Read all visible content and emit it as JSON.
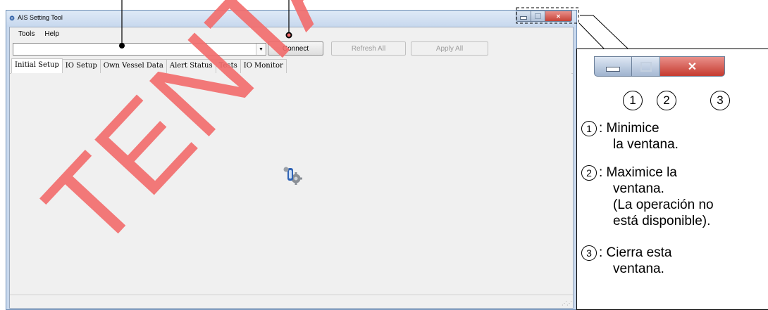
{
  "window": {
    "title": "AIS Setting Tool",
    "app_icon": "ais-app-icon"
  },
  "menu": [
    "Tools",
    "Help"
  ],
  "toolbar": {
    "port_value": "",
    "connect_label": "Connect",
    "refresh_label": "Refresh All",
    "apply_label": "Apply All"
  },
  "tabs": [
    {
      "label": "Initial Setup",
      "active": true
    },
    {
      "label": "IO Setup"
    },
    {
      "label": "Own Vessel Data"
    },
    {
      "label": "Alert Status"
    },
    {
      "label": "Tests"
    },
    {
      "label": "IO Monitor"
    }
  ],
  "watermark": "TENTATIVE",
  "legend": {
    "numbers": [
      "1",
      "2",
      "3"
    ],
    "items": [
      {
        "num": "1",
        "lines": [
          ": Minimice",
          "la ventana."
        ]
      },
      {
        "num": "2",
        "lines": [
          ": Maximice la",
          "ventana.",
          "(La operación no",
          "está disponible)."
        ]
      },
      {
        "num": "3",
        "lines": [
          ": Cierra esta",
          "ventana."
        ]
      }
    ]
  },
  "colors": {
    "watermark": "#f26a6a",
    "accent": "#c53a2f",
    "window_frame": "#c9d9ee"
  }
}
